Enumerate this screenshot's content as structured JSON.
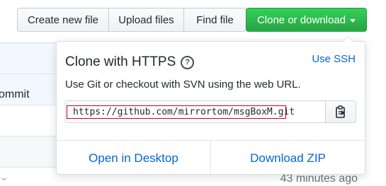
{
  "toolbar": {
    "create_new_file": "Create new file",
    "upload_files": "Upload files",
    "find_file": "Find file",
    "clone_or_download": "Clone or download"
  },
  "background": {
    "commit_fragment": "ommit",
    "glyph_fragment": "⌄",
    "time_fragment": "43 minutes ago"
  },
  "clone_panel": {
    "title": "Clone with HTTPS",
    "use_ssh": "Use SSH",
    "description": "Use Git or checkout with SVN using the web URL.",
    "url": "https://github.com/mirrortom/msgBoxM.git",
    "open_in_desktop": "Open in Desktop",
    "download_zip": "Download ZIP"
  },
  "colors": {
    "clone_button_green": "#28a745",
    "link_blue": "#0366d6",
    "highlight_red": "#d0021b"
  }
}
